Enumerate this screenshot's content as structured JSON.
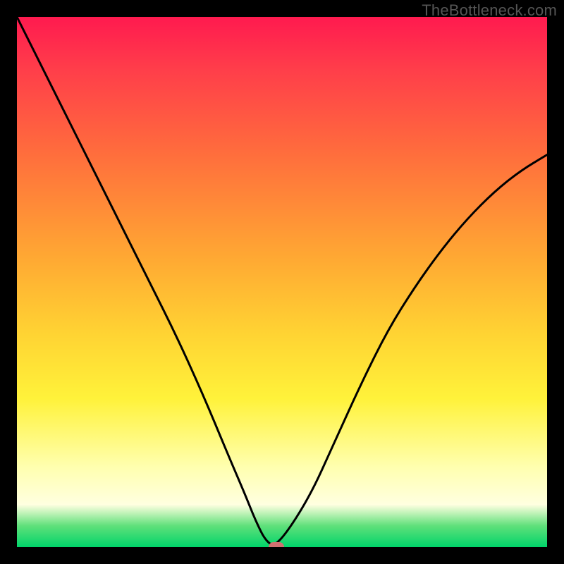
{
  "watermark_text": "TheBottleneck.com",
  "chart_data": {
    "type": "line",
    "title": "",
    "xlabel": "",
    "ylabel": "",
    "xlim": [
      0,
      100
    ],
    "ylim": [
      0,
      100
    ],
    "background_gradient": {
      "orientation": "vertical",
      "stops": [
        {
          "pos": 0,
          "color": "#ff1a4f"
        },
        {
          "pos": 25,
          "color": "#ff6b3d"
        },
        {
          "pos": 60,
          "color": "#ffd433"
        },
        {
          "pos": 85,
          "color": "#ffffb0"
        },
        {
          "pos": 96,
          "color": "#5fe07a"
        },
        {
          "pos": 100,
          "color": "#00d46a"
        }
      ]
    },
    "series": [
      {
        "name": "bottleneck-curve",
        "x": [
          0,
          5,
          10,
          15,
          20,
          25,
          30,
          35,
          40,
          43,
          45,
          47,
          49,
          55,
          60,
          65,
          70,
          75,
          80,
          85,
          90,
          95,
          100
        ],
        "y": [
          100,
          90,
          80,
          70,
          60,
          50,
          40,
          29,
          17,
          10,
          5,
          1,
          0,
          9,
          20,
          31,
          41,
          49,
          56,
          62,
          67,
          71,
          74
        ]
      }
    ],
    "marker": {
      "x": 49,
      "y": 0,
      "color": "#d07070"
    }
  }
}
